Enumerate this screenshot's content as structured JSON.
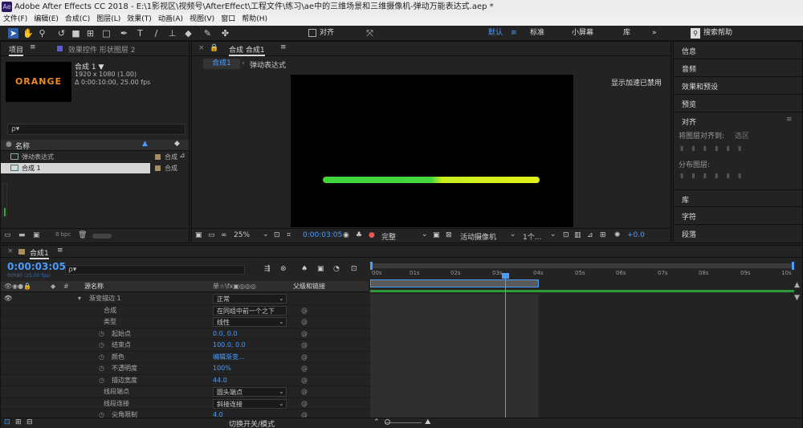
{
  "app": {
    "title": "Adobe After Effects CC 2018 - E:\\1影视区\\视频号\\AfterEffect\\工程文件\\练习\\ae中的三维场景和三维摄像机-弹动万能表达式.aep *"
  },
  "menu": [
    "文件(F)",
    "编辑(E)",
    "合成(C)",
    "图层(L)",
    "效果(T)",
    "动画(A)",
    "视图(V)",
    "窗口",
    "帮助(H)"
  ],
  "toolbar": {
    "align_label": "对齐",
    "workspaces": [
      "默认",
      "标准",
      "小屏幕",
      "库"
    ],
    "search_placeholder": "搜索帮助",
    "more": "»"
  },
  "project": {
    "tab": "项目",
    "effects_tab": "效果控件 形状图层 2",
    "thumb_text": "ORANGE",
    "comp_name": "合成 1 ▼",
    "comp_info1": "1920 x 1080 (1.00)",
    "comp_info2": "Δ 0:00:10:00, 25.00 fps",
    "search_placeholder": "ρ▾",
    "col_name": "名称",
    "items": [
      {
        "name": "弹动表达式",
        "type": "合成"
      },
      {
        "name": "合成 1",
        "type": "合成"
      }
    ],
    "bpc": "8 bpc"
  },
  "viewer": {
    "tab": "合成 合成1",
    "breadcrumbs": [
      "合成1",
      "弹动表达式"
    ],
    "accel_msg": "显示加速已禁用",
    "zoom": "25%",
    "timecode": "0:00:03:05",
    "quality": "完整",
    "camera": "活动摄像机",
    "views": "1个...",
    "exposure": "+0.0",
    "colors": {
      "line_start": "#3fd63a",
      "line_end": "#e2f01a"
    }
  },
  "right_panel": {
    "items": [
      "信息",
      "音频",
      "效果和预设",
      "预览",
      "对齐"
    ],
    "align_to_label": "将图层对齐到:",
    "align_to_value": "选区",
    "distribute_label": "分布图层:",
    "bottom_items": [
      "库",
      "字符",
      "段落"
    ]
  },
  "timeline": {
    "tab": "合成1",
    "timecode": "0:00:03:05",
    "timecode_sub": "00080 (25.00 fps)",
    "search_placeholder": "ρ▾",
    "col_source": "源名称",
    "col_switches": "单☆\\fx▣◎◎◎",
    "col_parent": "父级和链接",
    "ruler": [
      "00s",
      "01s",
      "02s",
      "03s",
      "04s",
      "05s",
      "06s",
      "07s",
      "08s",
      "09s",
      "10s"
    ],
    "rows": [
      {
        "indent": 0,
        "name": "渐变描边 1",
        "value": "正常",
        "kind": "dropdown",
        "stopwatch": false
      },
      {
        "indent": 1,
        "name": "合成",
        "value": "在同组中前一个之下",
        "kind": "dropdown",
        "stopwatch": false
      },
      {
        "indent": 1,
        "name": "类型",
        "value": "线性",
        "kind": "dropdown",
        "stopwatch": false
      },
      {
        "indent": 1,
        "name": "起始点",
        "value": "0.0, 0.0",
        "kind": "num",
        "stopwatch": true
      },
      {
        "indent": 1,
        "name": "结束点",
        "value": "100.0, 0.0",
        "kind": "num",
        "stopwatch": true
      },
      {
        "indent": 1,
        "name": "颜色",
        "value": "编辑渐变...",
        "kind": "num",
        "stopwatch": true
      },
      {
        "indent": 1,
        "name": "不透明度",
        "value": "100%",
        "kind": "num",
        "stopwatch": true
      },
      {
        "indent": 1,
        "name": "描边宽度",
        "value": "44.0",
        "kind": "num",
        "stopwatch": true
      },
      {
        "indent": 1,
        "name": "线段端点",
        "value": "圆头端点",
        "kind": "dropdown",
        "stopwatch": false
      },
      {
        "indent": 1,
        "name": "线段连接",
        "value": "斜接连接",
        "kind": "dropdown",
        "stopwatch": false
      },
      {
        "indent": 1,
        "name": "尖角限制",
        "value": "4.0",
        "kind": "num",
        "stopwatch": true
      }
    ],
    "footer_toggle": "切换开关/模式"
  }
}
